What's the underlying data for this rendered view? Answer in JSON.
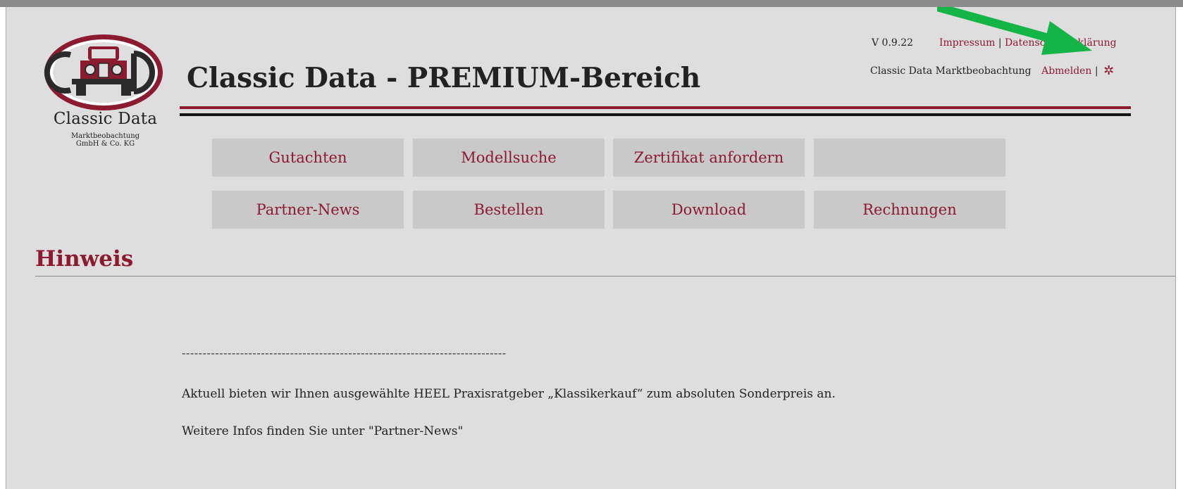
{
  "brand": {
    "logo_text": "Classic Data",
    "logo_sub_1": "Marktbeobachtung",
    "logo_sub_2": "GmbH & Co. KG",
    "colors": {
      "accent": "#8c1a30",
      "text": "#222222",
      "page_bg": "#dedede",
      "button_bg": "#c9c9c9",
      "annotation_arrow": "#14b446"
    }
  },
  "header": {
    "title": "Classic Data - PREMIUM-Bereich",
    "version": "V 0.9.22",
    "impressum_label": "Impressum",
    "separator": "|",
    "datenschutz_label": "Datenschutzerklärung",
    "user_label": "Classic Data Marktbeobachtung",
    "logout_label": "Abmelden",
    "settings_icon": "gear-icon"
  },
  "nav": {
    "row1": [
      "Gutachten",
      "Modellsuche",
      "Zertifikat anfordern",
      ""
    ],
    "row2": [
      "Partner-News",
      "Bestellen",
      "Download",
      "Rechnungen"
    ]
  },
  "notice": {
    "heading": "Hinweis",
    "divider": "------------------------------------------------------------------------------",
    "line1": "Aktuell bieten wir Ihnen ausgewählte HEEL Praxisratgeber „Klassikerkauf“ zum absoluten Sonderpreis an.",
    "line2": "Weitere Infos finden Sie unter \"Partner-News\""
  }
}
